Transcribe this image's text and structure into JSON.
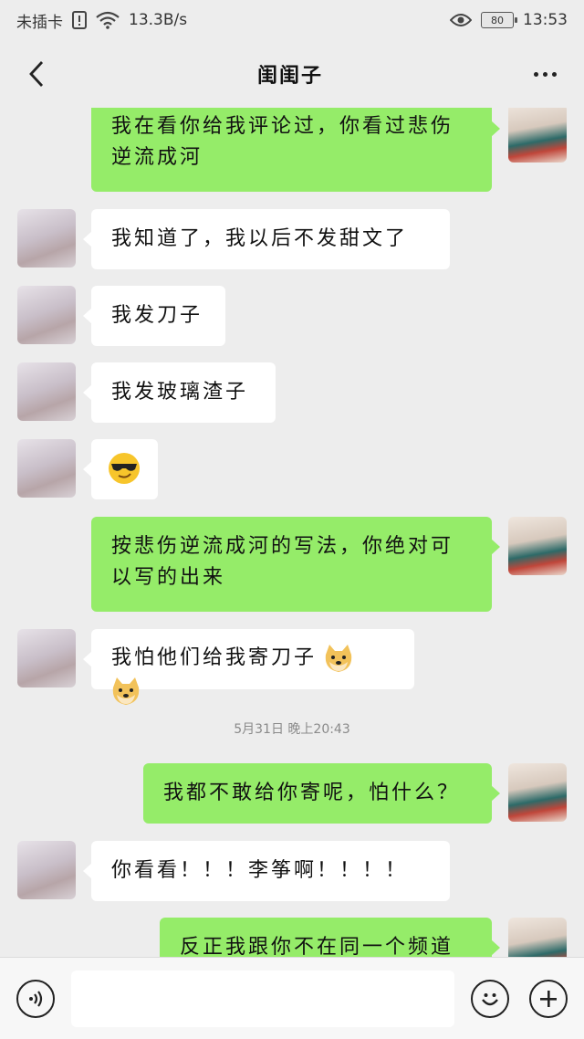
{
  "status_bar": {
    "carrier": "未插卡",
    "speed": "13.3B/s",
    "battery": "80",
    "time": "13:53"
  },
  "header": {
    "title": "闺闺子"
  },
  "messages": [
    {
      "from": "me",
      "text_lines": [
        "我在看你给我评论过，你看过悲伤",
        "逆流成河"
      ]
    },
    {
      "from": "friend",
      "text": "我知道了，我以后不发甜文了"
    },
    {
      "from": "friend",
      "text": "我发刀子"
    },
    {
      "from": "friend",
      "text": "我发玻璃渣子"
    },
    {
      "from": "friend",
      "emoji": "sunglasses-emoji"
    },
    {
      "from": "me",
      "text_lines": [
        "按悲伤逆流成河的写法，你绝对可",
        "以写的出来"
      ]
    },
    {
      "from": "friend",
      "text": "我怕他们给我寄刀子",
      "emoji": "doge-emoji"
    },
    {
      "timestamp": "5月31日 晚上20:43"
    },
    {
      "from": "me",
      "text": "我都不敢给你寄呢，怕什么？"
    },
    {
      "from": "friend",
      "text": "你看看！！！李筝啊！！！！"
    },
    {
      "from": "me",
      "text": "反正我跟你不在同一个频道"
    }
  ],
  "input_bar": {
    "voice_icon": "voice-icon",
    "emoji_icon": "emoji-icon",
    "plus_icon": "plus-icon"
  },
  "colors": {
    "background": "#ededed",
    "my_bubble": "#95ec69",
    "friend_bubble": "#ffffff"
  }
}
